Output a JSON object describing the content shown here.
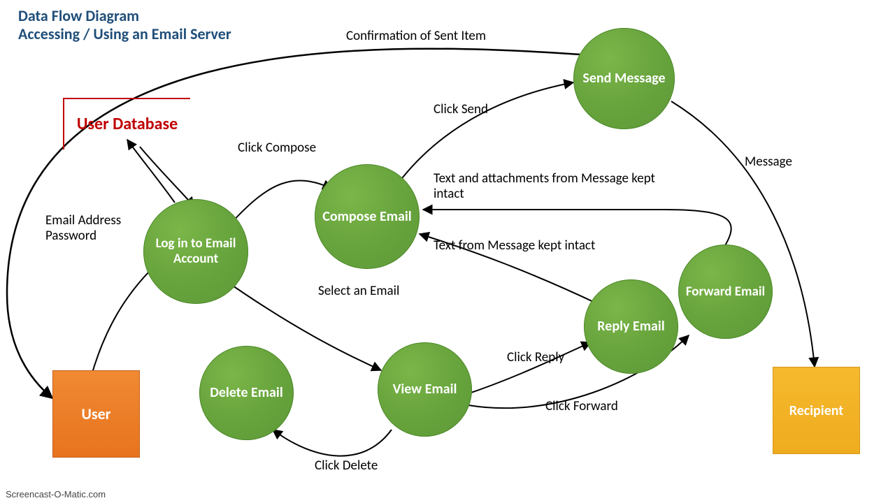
{
  "title": {
    "line1": "Data Flow Diagram",
    "line2": "Accessing / Using an Email Server"
  },
  "entities": {
    "user": "User",
    "recipient": "Recipient",
    "user_database": "User Database"
  },
  "processes": {
    "login": "Log in to Email Account",
    "compose": "Compose Email",
    "send": "Send Message",
    "view": "View Email",
    "reply": "Reply Email",
    "forward": "Forward Email",
    "delete": "Delete Email"
  },
  "flows": {
    "confirmation": "Confirmation of Sent Item",
    "click_send": "Click Send",
    "click_compose": "Click Compose",
    "message": "Message",
    "text_attachments": "Text and attachments from Message kept intact",
    "text_only": "Text from Message kept intact",
    "email_pw": "Email Address Password",
    "select_email": "Select an Email",
    "click_reply": "Click Reply",
    "click_forward": "Click Forward",
    "click_delete": "Click Delete"
  },
  "watermark": "Screencast-O-Matic.com"
}
